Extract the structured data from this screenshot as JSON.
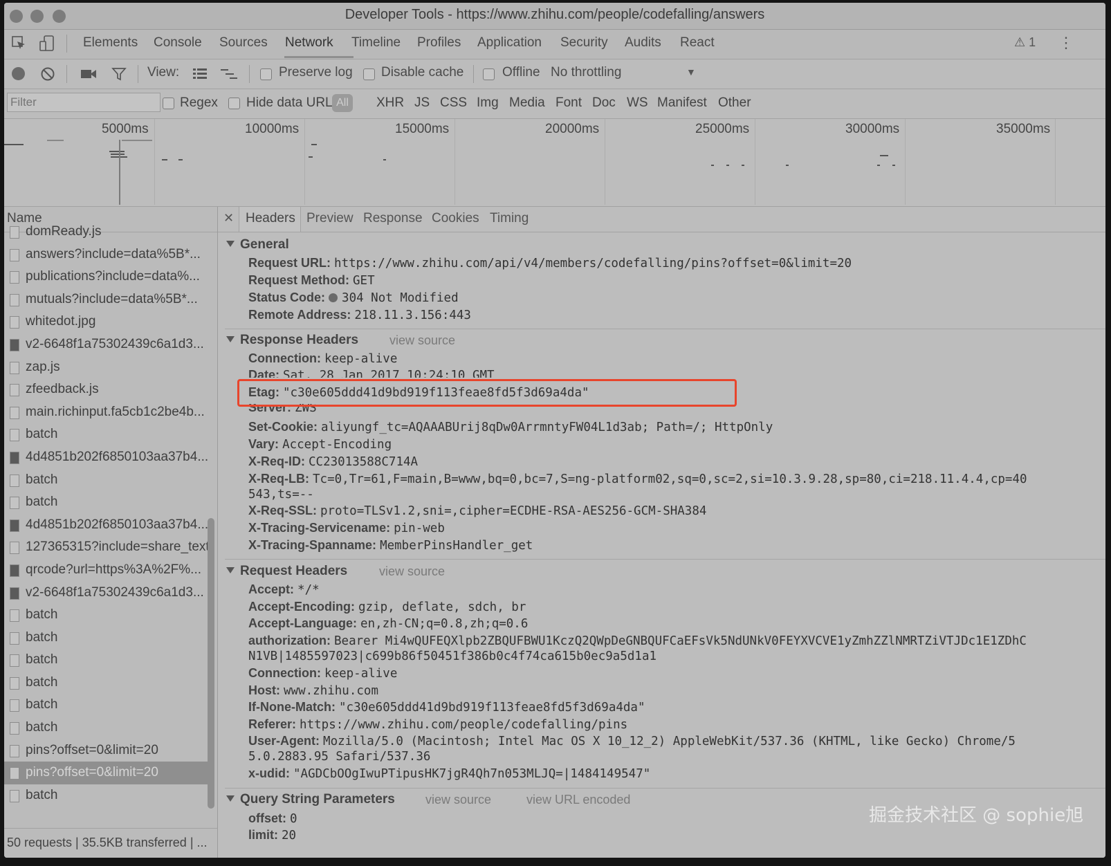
{
  "window": {
    "title": "Developer Tools - https://www.zhihu.com/people/codefalling/answers"
  },
  "main_tabs": [
    "Elements",
    "Console",
    "Sources",
    "Network",
    "Timeline",
    "Profiles",
    "Application",
    "Security",
    "Audits",
    "React"
  ],
  "warning_count": "1",
  "toolbar": {
    "view_label": "View:",
    "preserve_log": "Preserve log",
    "disable_cache": "Disable cache",
    "offline": "Offline",
    "throttling": "No throttling"
  },
  "filterbar": {
    "placeholder": "Filter",
    "regex": "Regex",
    "hide_data_urls": "Hide data URLs",
    "all": "All",
    "types": [
      "XHR",
      "JS",
      "CSS",
      "Img",
      "Media",
      "Font",
      "Doc",
      "WS",
      "Manifest",
      "Other"
    ]
  },
  "timeline": {
    "ticks": [
      "5000ms",
      "10000ms",
      "15000ms",
      "20000ms",
      "25000ms",
      "30000ms",
      "35000ms"
    ]
  },
  "name_panel": {
    "header": "Name",
    "rows": [
      {
        "name": "domReady.js",
        "icon": "file"
      },
      {
        "name": "answers?include=data%5B*...",
        "icon": "file"
      },
      {
        "name": "publications?include=data%...",
        "icon": "file"
      },
      {
        "name": "mutuals?include=data%5B*...",
        "icon": "file"
      },
      {
        "name": "whitedot.jpg",
        "icon": "file"
      },
      {
        "name": "v2-6648f1a75302439c6a1d3...",
        "icon": "image"
      },
      {
        "name": "zap.js",
        "icon": "file"
      },
      {
        "name": "zfeedback.js",
        "icon": "file"
      },
      {
        "name": "main.richinput.fa5cb1c2be4b...",
        "icon": "file"
      },
      {
        "name": "batch",
        "icon": "file"
      },
      {
        "name": "4d4851b202f6850103aa37b4...",
        "icon": "image"
      },
      {
        "name": "batch",
        "icon": "file"
      },
      {
        "name": "batch",
        "icon": "file"
      },
      {
        "name": "4d4851b202f6850103aa37b4...",
        "icon": "image"
      },
      {
        "name": "127365315?include=share_text",
        "icon": "file"
      },
      {
        "name": "qrcode?url=https%3A%2F%...",
        "icon": "image"
      },
      {
        "name": "v2-6648f1a75302439c6a1d3...",
        "icon": "image"
      },
      {
        "name": "batch",
        "icon": "file"
      },
      {
        "name": "batch",
        "icon": "file"
      },
      {
        "name": "batch",
        "icon": "file"
      },
      {
        "name": "batch",
        "icon": "file"
      },
      {
        "name": "batch",
        "icon": "file"
      },
      {
        "name": "batch",
        "icon": "file"
      },
      {
        "name": "pins?offset=0&limit=20",
        "icon": "file"
      },
      {
        "name": "pins?offset=0&limit=20",
        "icon": "file",
        "selected": true
      },
      {
        "name": "batch",
        "icon": "file"
      }
    ],
    "status": "50 requests | 35.5KB transferred | ..."
  },
  "detail_tabs": [
    "Headers",
    "Preview",
    "Response",
    "Cookies",
    "Timing"
  ],
  "general": {
    "title": "General",
    "items": [
      {
        "k": "Request URL:",
        "v": "https://www.zhihu.com/api/v4/members/codefalling/pins?offset=0&limit=20"
      },
      {
        "k": "Request Method:",
        "v": "GET"
      },
      {
        "k": "Status Code:",
        "v": "304 Not Modified"
      },
      {
        "k": "Remote Address:",
        "v": "218.11.3.156:443"
      }
    ]
  },
  "response_headers": {
    "title": "Response Headers",
    "view_source": "view source",
    "items": [
      {
        "k": "Connection:",
        "v": "keep-alive"
      },
      {
        "k": "Date:",
        "v": "Sat, 28 Jan 2017 10:24:10 GMT"
      },
      {
        "k": "Etag:",
        "v": "\"c30e605ddd41d9bd919f113feae8fd5f3d69a4da\""
      },
      {
        "k": "Server:",
        "v": "ZWS"
      },
      {
        "k": "Set-Cookie:",
        "v": "aliyungf_tc=AQAAABUrij8qDw0ArrmntyFW04L1d3ab; Path=/; HttpOnly"
      },
      {
        "k": "Vary:",
        "v": "Accept-Encoding"
      },
      {
        "k": "X-Req-ID:",
        "v": "CC23013588C714A"
      },
      {
        "k": "X-Req-LB:",
        "v": "Tc=0,Tr=61,F=main,B=www,bq=0,bc=7,S=ng-platform02,sq=0,sc=2,si=10.3.9.28,sp=80,ci=218.11.4.4,cp=40",
        "cont": "543,ts=--"
      },
      {
        "k": "X-Req-SSL:",
        "v": "proto=TLSv1.2,sni=,cipher=ECDHE-RSA-AES256-GCM-SHA384"
      },
      {
        "k": "X-Tracing-Servicename:",
        "v": "pin-web"
      },
      {
        "k": "X-Tracing-Spanname:",
        "v": "MemberPinsHandler_get"
      }
    ]
  },
  "request_headers": {
    "title": "Request Headers",
    "view_source": "view source",
    "items": [
      {
        "k": "Accept:",
        "v": "*/*"
      },
      {
        "k": "Accept-Encoding:",
        "v": "gzip, deflate, sdch, br"
      },
      {
        "k": "Accept-Language:",
        "v": "en,zh-CN;q=0.8,zh;q=0.6"
      },
      {
        "k": "authorization:",
        "v": "Bearer Mi4wQUFEQXlpb2ZBQUFBWU1KczQ2QWpDeGNBQUFCaEFsVk5NdUNkV0FEYXVCVE1yZmhZZlNMRTZiVTJDc1E1ZDhC",
        "cont": "N1VB|1485597023|c699b86f50451f386b0c4f74ca615b0ec9a5d1a1"
      },
      {
        "k": "Connection:",
        "v": "keep-alive"
      },
      {
        "k": "Host:",
        "v": "www.zhihu.com"
      },
      {
        "k": "If-None-Match:",
        "v": "\"c30e605ddd41d9bd919f113feae8fd5f3d69a4da\""
      },
      {
        "k": "Referer:",
        "v": "https://www.zhihu.com/people/codefalling/pins"
      },
      {
        "k": "User-Agent:",
        "v": "Mozilla/5.0 (Macintosh; Intel Mac OS X 10_12_2) AppleWebKit/537.36 (KHTML, like Gecko) Chrome/5",
        "cont": "5.0.2883.95 Safari/537.36"
      },
      {
        "k": "x-udid:",
        "v": "\"AGDCbOOgIwuPTipusHK7jgR4Qh7n053MLJQ=|1484149547\""
      }
    ]
  },
  "query_params": {
    "title": "Query String Parameters",
    "view_source": "view source",
    "view_url_encoded": "view URL encoded",
    "items": [
      {
        "k": "offset:",
        "v": "0"
      },
      {
        "k": "limit:",
        "v": "20"
      }
    ]
  },
  "watermark": "掘金技术社区 @ sophie旭",
  "colors": {
    "highlight": "#e8452c"
  }
}
